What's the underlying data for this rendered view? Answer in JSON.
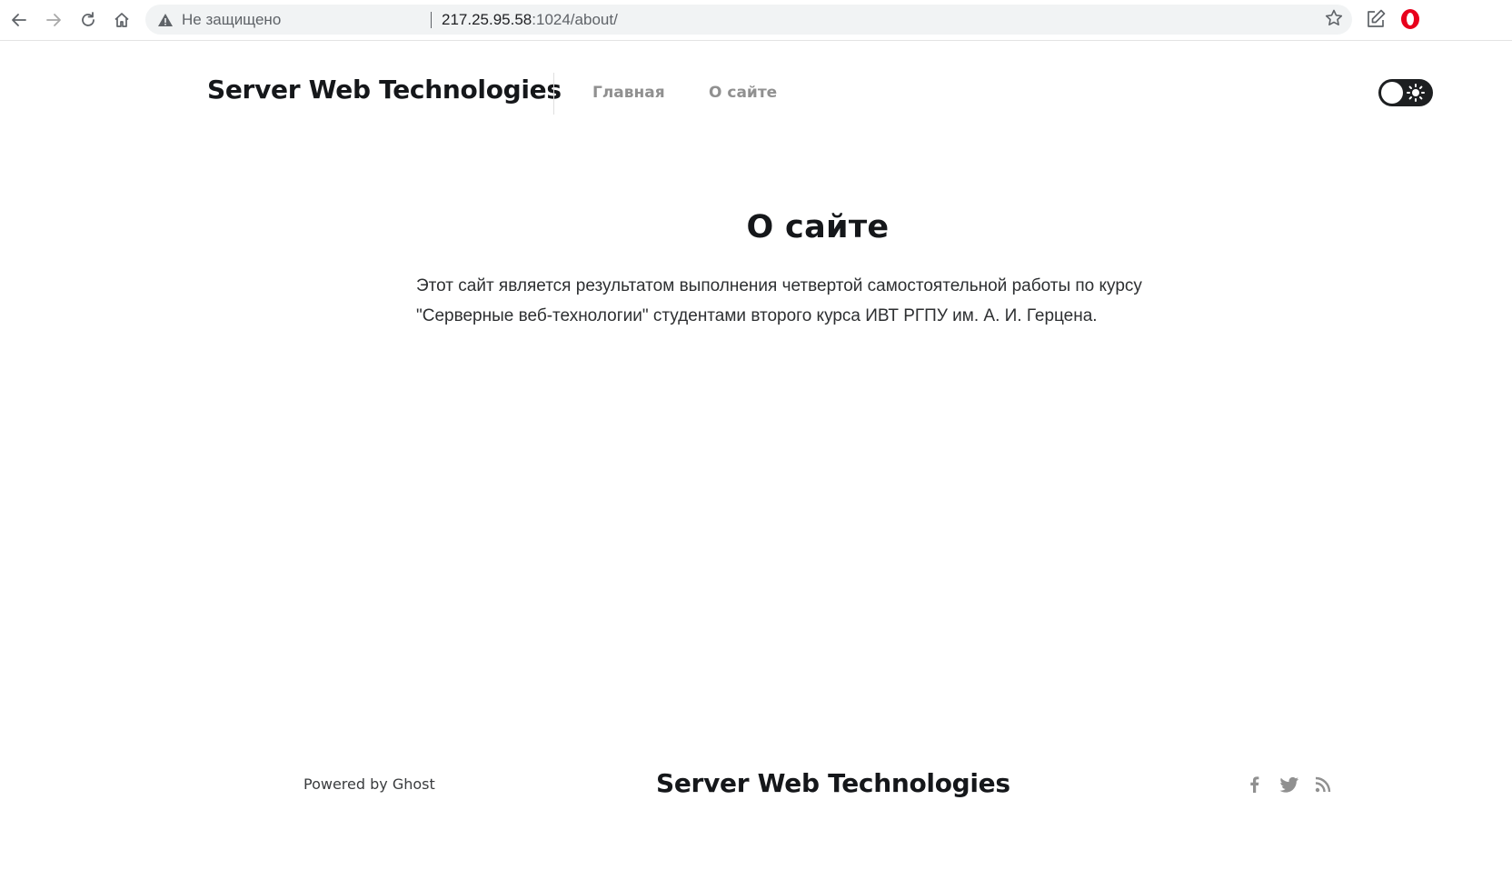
{
  "browser": {
    "security_label": "Не защищено",
    "url_host": "217.25.95.58",
    "url_path": ":1024/about/"
  },
  "header": {
    "site_title": "Server Web Technologies",
    "nav": [
      {
        "label": "Главная"
      },
      {
        "label": "О сайте"
      }
    ],
    "theme_toggle_state": "light"
  },
  "content": {
    "title": "О сайте",
    "paragraph_line1": "Этот сайт является результатом выполнения четвертой самостоятельной работы по курсу",
    "paragraph_line2": "\"Серверные веб-технологии\" студентами второго курса ИВТ РГПУ им. А. И. Герцена."
  },
  "footer": {
    "powered_by": "Powered by Ghost",
    "site_title": "Server Web Technologies",
    "social_icons": [
      "facebook-icon",
      "twitter-icon",
      "rss-icon"
    ]
  },
  "colors": {
    "text_dark": "#15171a",
    "nav_gray": "#909090",
    "toggle_bg": "#1d1f21",
    "omnibox_bg": "#f1f3f4",
    "opera_red": "#e8001c"
  }
}
